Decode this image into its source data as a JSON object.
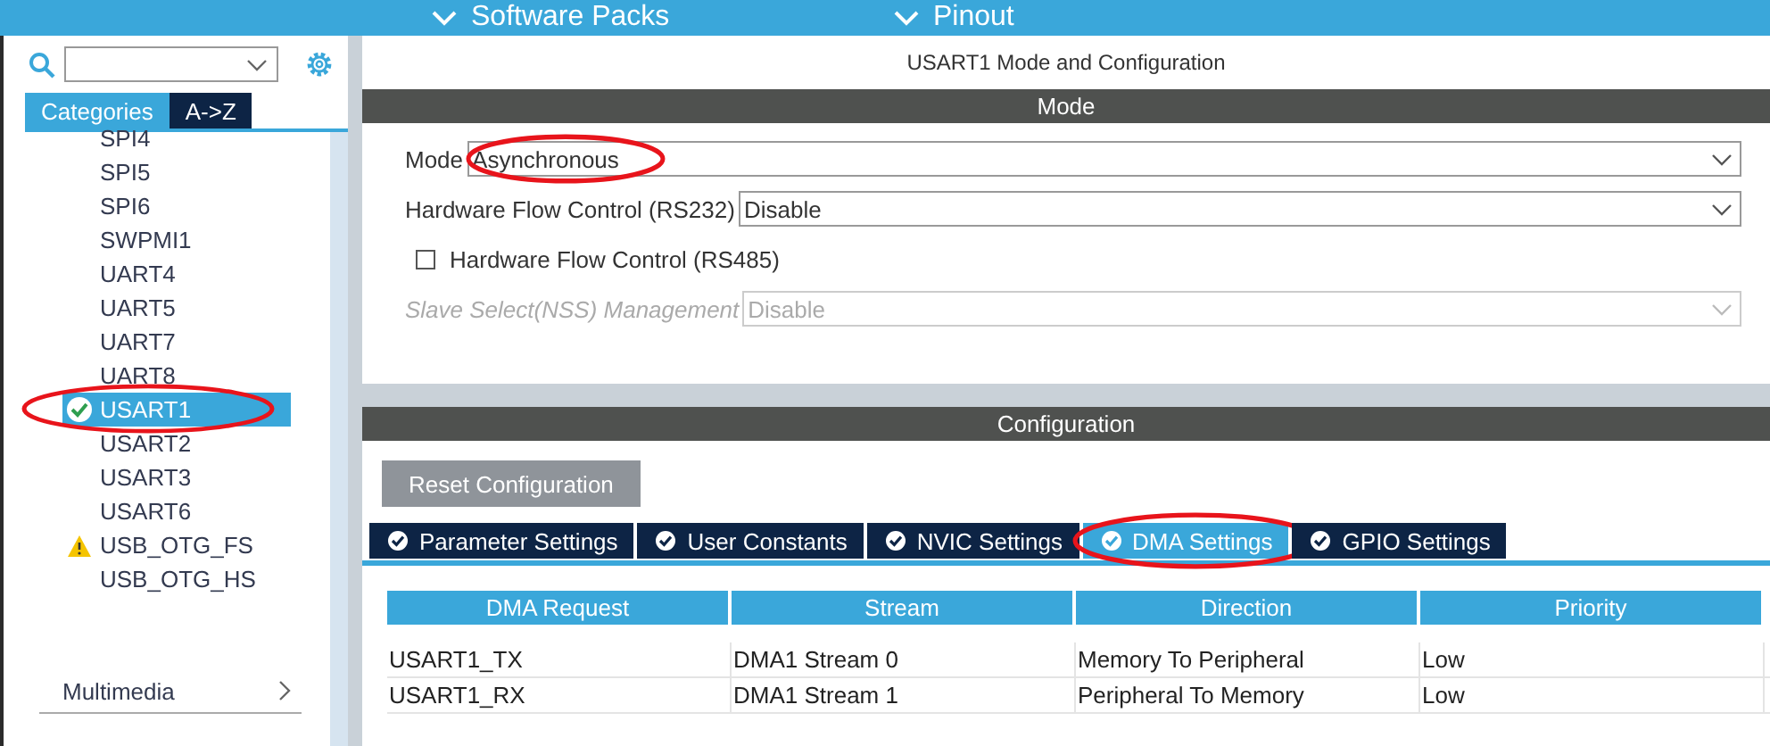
{
  "top_bar": {
    "items": [
      {
        "label": "Software Packs"
      },
      {
        "label": "Pinout"
      }
    ]
  },
  "sidebar": {
    "tabs": [
      {
        "label": "Categories",
        "selected": true
      },
      {
        "label": "A->Z",
        "selected": false
      }
    ],
    "items": [
      {
        "label": "SPI4",
        "selected": false,
        "configured": false,
        "warning": false,
        "circled": false
      },
      {
        "label": "SPI5",
        "selected": false,
        "configured": false,
        "warning": false,
        "circled": false
      },
      {
        "label": "SPI6",
        "selected": false,
        "configured": false,
        "warning": false,
        "circled": false
      },
      {
        "label": "SWPMI1",
        "selected": false,
        "configured": false,
        "warning": false,
        "circled": false
      },
      {
        "label": "UART4",
        "selected": false,
        "configured": false,
        "warning": false,
        "circled": false
      },
      {
        "label": "UART5",
        "selected": false,
        "configured": false,
        "warning": false,
        "circled": false
      },
      {
        "label": "UART7",
        "selected": false,
        "configured": false,
        "warning": false,
        "circled": false
      },
      {
        "label": "UART8",
        "selected": false,
        "configured": false,
        "warning": false,
        "circled": false
      },
      {
        "label": "USART1",
        "selected": true,
        "configured": true,
        "warning": false,
        "circled": true
      },
      {
        "label": "USART2",
        "selected": false,
        "configured": false,
        "warning": false,
        "circled": false
      },
      {
        "label": "USART3",
        "selected": false,
        "configured": false,
        "warning": false,
        "circled": false
      },
      {
        "label": "USART6",
        "selected": false,
        "configured": false,
        "warning": false,
        "circled": false
      },
      {
        "label": "USB_OTG_FS",
        "selected": false,
        "configured": false,
        "warning": true,
        "circled": false
      },
      {
        "label": "USB_OTG_HS",
        "selected": false,
        "configured": false,
        "warning": false,
        "circled": false
      }
    ],
    "footer": "Multimedia"
  },
  "panel": {
    "title": "USART1 Mode and Configuration",
    "mode": {
      "heading": "Mode",
      "fields": [
        {
          "kind": "select",
          "label": "Mode",
          "value": "Asynchronous",
          "disabled": false,
          "circled": true
        },
        {
          "kind": "select",
          "label": "Hardware Flow Control (RS232)",
          "value": "Disable",
          "disabled": false,
          "circled": false
        },
        {
          "kind": "checkbox",
          "label": "Hardware Flow Control (RS485)",
          "checked": false
        },
        {
          "kind": "select",
          "label": "Slave Select(NSS) Management",
          "value": "Disable",
          "disabled": true,
          "circled": false
        }
      ]
    },
    "configuration": {
      "heading": "Configuration",
      "reset_button": "Reset Configuration",
      "tabs": [
        {
          "label": "Parameter Settings",
          "selected": false,
          "circled": false
        },
        {
          "label": "User Constants",
          "selected": false,
          "circled": false
        },
        {
          "label": "NVIC Settings",
          "selected": false,
          "circled": false
        },
        {
          "label": "DMA Settings",
          "selected": true,
          "circled": true
        },
        {
          "label": "GPIO Settings",
          "selected": false,
          "circled": false
        }
      ],
      "table": {
        "columns": [
          "DMA Request",
          "Stream",
          "Direction",
          "Priority"
        ],
        "rows": [
          [
            "USART1_TX",
            "DMA1 Stream 0",
            "Memory To Peripheral",
            "Low"
          ],
          [
            "USART1_RX",
            "DMA1 Stream 1",
            "Peripheral To Memory",
            "Low"
          ]
        ]
      }
    }
  }
}
